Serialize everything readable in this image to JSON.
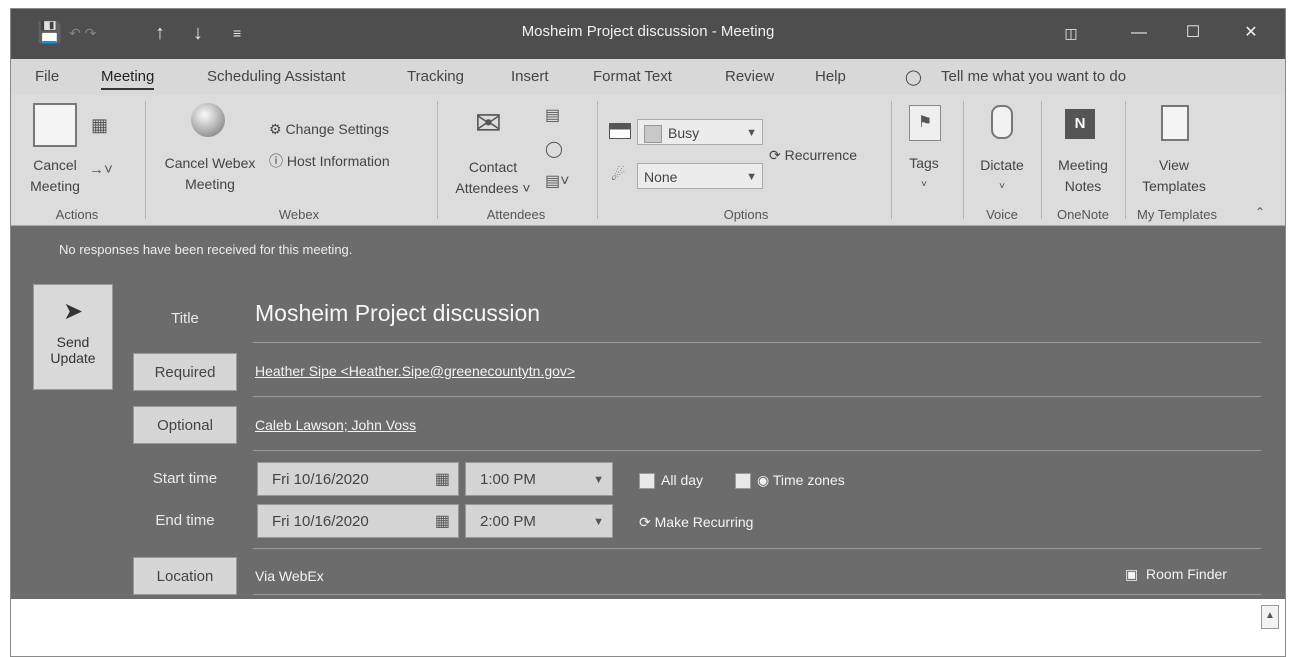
{
  "titlebar": {
    "title": "Mosheim Project discussion  -  Meeting",
    "icons": [
      "save-icon",
      "up-arrow-icon",
      "down-arrow-icon",
      "customize-icon"
    ],
    "controls": [
      "ribbon-display-icon",
      "minimize-icon",
      "maximize-icon",
      "close-icon"
    ]
  },
  "tabs": [
    {
      "label": "File"
    },
    {
      "label": "Meeting"
    },
    {
      "label": "Scheduling Assistant"
    },
    {
      "label": "Tracking"
    },
    {
      "label": "Insert"
    },
    {
      "label": "Format Text"
    },
    {
      "label": "Review"
    },
    {
      "label": "Help"
    }
  ],
  "tell_me": "Tell me what you want to do",
  "ribbon": {
    "actions": {
      "cancel_line1": "Cancel",
      "cancel_line2": "Meeting",
      "group": "Actions"
    },
    "webex": {
      "cancel_line1": "Cancel Webex",
      "cancel_line2": "Meeting",
      "change_settings": "Change Settings",
      "host_information": "Host Information",
      "group": "Webex"
    },
    "attendees": {
      "contact_line1": "Contact",
      "contact_line2": "Attendees",
      "group": "Attendees"
    },
    "options": {
      "show_as": "Busy",
      "reminder": "None",
      "recurrence": "Recurrence",
      "group": "Options"
    },
    "tags": {
      "label": "Tags"
    },
    "voice": {
      "dictate": "Dictate",
      "group": "Voice"
    },
    "onenote": {
      "line1": "Meeting",
      "line2": "Notes",
      "group": "OneNote"
    },
    "templates": {
      "line1": "View",
      "line2": "Templates",
      "group": "My Templates"
    }
  },
  "form": {
    "notice": "No responses have been received for this meeting.",
    "send_line1": "Send",
    "send_line2": "Update",
    "title_label": "Title",
    "title_value": "Mosheim Project discussion",
    "required_label": "Required",
    "required_value": "Heather Sipe <Heather.Sipe@greenecountytn.gov>",
    "optional_label": "Optional",
    "optional_value": "Caleb Lawson; John Voss",
    "start_label": "Start time",
    "start_date": "Fri 10/16/2020",
    "start_time": "1:00 PM",
    "end_label": "End time",
    "end_date": "Fri 10/16/2020",
    "end_time": "2:00 PM",
    "all_day": "All day",
    "time_zones": "Time zones",
    "make_recurring": "Make Recurring",
    "location_label": "Location",
    "location_value": "Via WebEx",
    "room_finder": "Room Finder"
  }
}
